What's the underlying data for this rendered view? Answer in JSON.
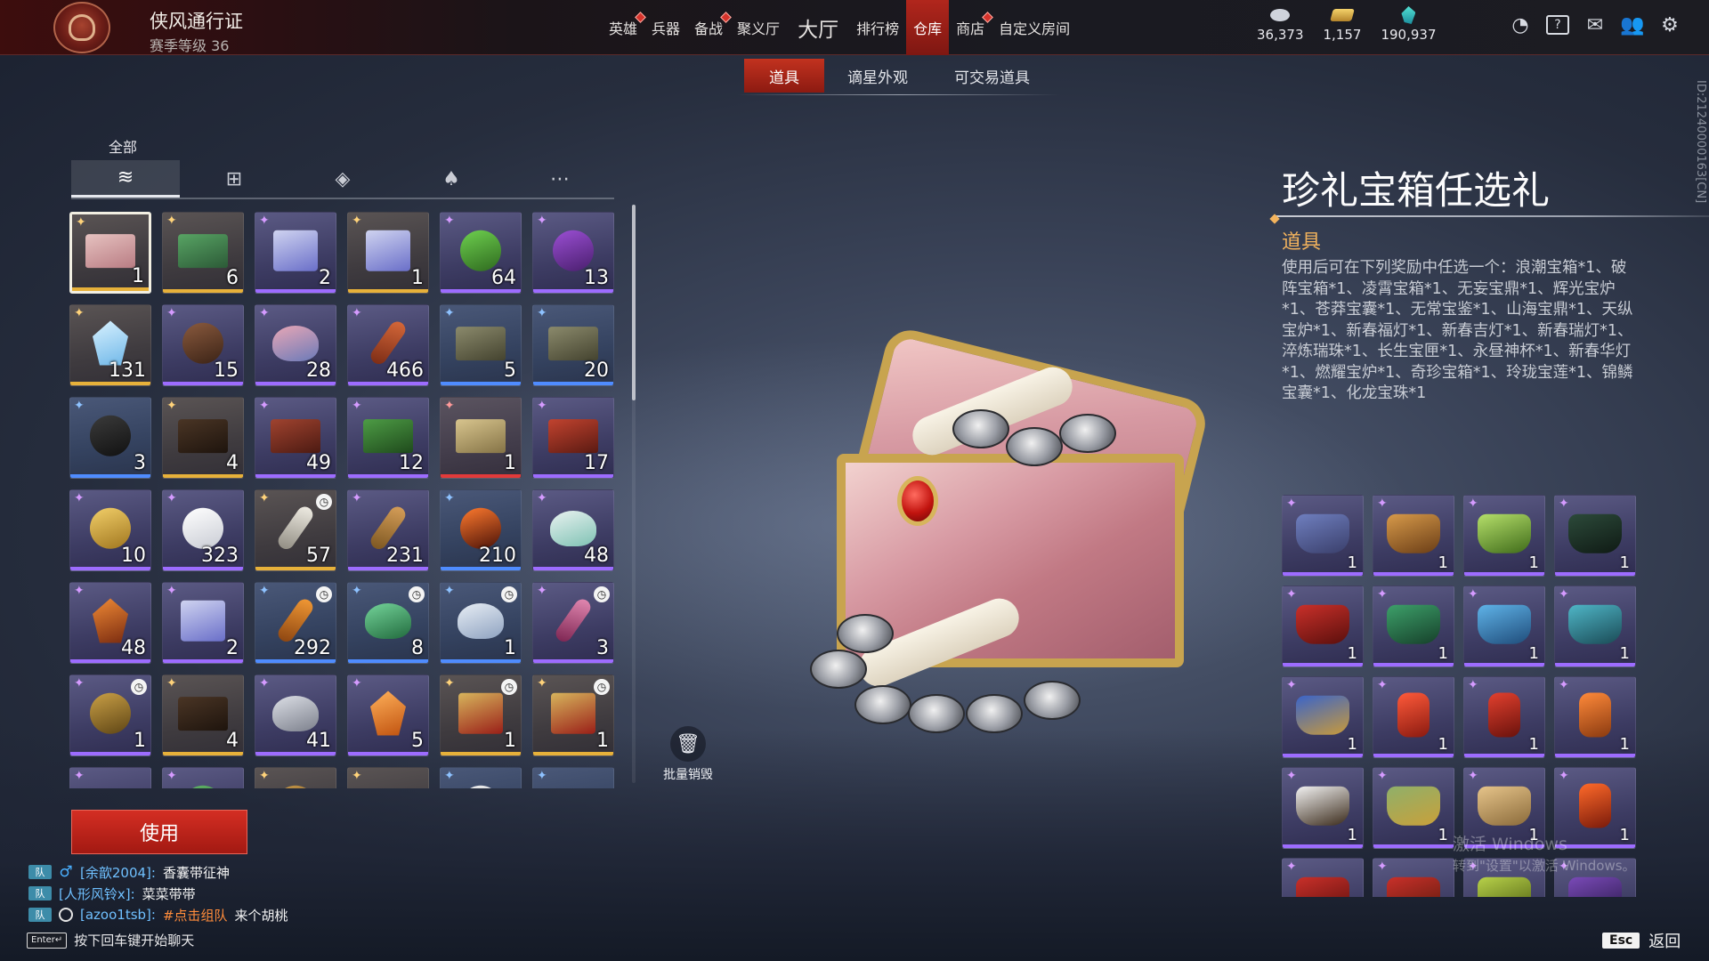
{
  "header": {
    "pass_title": "侠风通行证",
    "pass_level": "赛季等级 36",
    "nav": [
      {
        "label": "英雄",
        "badge": true,
        "size": "normal",
        "active": false
      },
      {
        "label": "兵器",
        "badge": false,
        "size": "normal",
        "active": false
      },
      {
        "label": "备战",
        "badge": true,
        "size": "normal",
        "active": false
      },
      {
        "label": "聚义厅",
        "badge": false,
        "size": "normal",
        "active": false
      },
      {
        "label": "大厅",
        "badge": false,
        "size": "big",
        "active": false
      },
      {
        "label": "排行榜",
        "badge": false,
        "size": "normal",
        "active": false
      },
      {
        "label": "仓库",
        "badge": false,
        "size": "normal",
        "active": true
      },
      {
        "label": "商店",
        "badge": true,
        "size": "normal",
        "active": false
      },
      {
        "label": "自定义房间",
        "badge": false,
        "size": "normal",
        "active": false
      }
    ],
    "currencies": [
      {
        "icon": "coin-pile-icon",
        "value": "36,373"
      },
      {
        "icon": "gold-bar-icon",
        "value": "1,157"
      },
      {
        "icon": "jade-crystal-icon",
        "value": "190,937"
      }
    ],
    "system_icons": [
      "timer-icon",
      "help-icon",
      "mail-icon",
      "friends-icon",
      "settings-icon"
    ]
  },
  "subtabs": [
    {
      "label": "道具",
      "active": true
    },
    {
      "label": "谪星外观",
      "active": false
    },
    {
      "label": "可交易道具",
      "active": false
    }
  ],
  "filters": {
    "active_label": "全部",
    "tabs": [
      {
        "icon": "layers-icon",
        "glyph": "≋",
        "active": true
      },
      {
        "icon": "gift-icon",
        "glyph": "⊞",
        "active": false
      },
      {
        "icon": "pouch-icon",
        "glyph": "◈",
        "active": false
      },
      {
        "icon": "flame-icon",
        "glyph": "♠",
        "active": false
      },
      {
        "icon": "more-icon",
        "glyph": "⋯",
        "active": false
      }
    ]
  },
  "inventory": [
    {
      "count": "1",
      "quality": "gold",
      "art": "chest",
      "colors": [
        "#e6c2c0",
        "#b97c83"
      ],
      "selected": true,
      "timed": false
    },
    {
      "count": "6",
      "quality": "gold",
      "art": "chest",
      "colors": [
        "#58a464",
        "#2c5a37"
      ],
      "selected": false,
      "timed": false
    },
    {
      "count": "2",
      "quality": "purple",
      "art": "box",
      "colors": [
        "#cfd3f0",
        "#6a6fc9"
      ],
      "selected": false,
      "timed": false
    },
    {
      "count": "1",
      "quality": "gold",
      "art": "box",
      "colors": [
        "#cfd3f0",
        "#6a6fc9"
      ],
      "selected": false,
      "timed": false
    },
    {
      "count": "64",
      "quality": "purple",
      "art": "orb",
      "colors": [
        "#6ed04f",
        "#2f6a1f"
      ],
      "selected": false,
      "timed": false
    },
    {
      "count": "13",
      "quality": "purple",
      "art": "orb",
      "colors": [
        "#9b4fd4",
        "#4a1f6e"
      ],
      "selected": false,
      "timed": false
    },
    {
      "count": "131",
      "quality": "gold",
      "art": "gem",
      "colors": [
        "#d9f2ff",
        "#6fb7e8"
      ],
      "selected": false,
      "timed": false
    },
    {
      "count": "15",
      "quality": "purple",
      "art": "orb",
      "colors": [
        "#8a5a3e",
        "#3b2316"
      ],
      "selected": false,
      "timed": false
    },
    {
      "count": "28",
      "quality": "purple",
      "art": "flower",
      "colors": [
        "#e9a7b6",
        "#6b7ab8"
      ],
      "selected": false,
      "timed": false
    },
    {
      "count": "466",
      "quality": "purple",
      "art": "key",
      "colors": [
        "#d7693a",
        "#7a2b15"
      ],
      "selected": false,
      "timed": false
    },
    {
      "count": "5",
      "quality": "blue",
      "art": "chest",
      "colors": [
        "#8b8a6c",
        "#44432f"
      ],
      "selected": false,
      "timed": false
    },
    {
      "count": "20",
      "quality": "blue",
      "art": "chest",
      "colors": [
        "#8b8a6c",
        "#44432f"
      ],
      "selected": false,
      "timed": false
    },
    {
      "count": "3",
      "quality": "blue",
      "art": "orb",
      "colors": [
        "#3b3b3b",
        "#111111"
      ],
      "selected": false,
      "timed": false
    },
    {
      "count": "4",
      "quality": "gold",
      "art": "chest",
      "colors": [
        "#4a3525",
        "#1e140d"
      ],
      "selected": false,
      "timed": false
    },
    {
      "count": "49",
      "quality": "purple",
      "art": "chest",
      "colors": [
        "#a0432f",
        "#4c1a12"
      ],
      "selected": false,
      "timed": false
    },
    {
      "count": "12",
      "quality": "purple",
      "art": "chest",
      "colors": [
        "#4d9c45",
        "#1f4a1c"
      ],
      "selected": false,
      "timed": false
    },
    {
      "count": "1",
      "quality": "red",
      "art": "chest",
      "colors": [
        "#d8c58e",
        "#857346"
      ],
      "selected": false,
      "timed": false
    },
    {
      "count": "17",
      "quality": "purple",
      "art": "chest",
      "colors": [
        "#c2432f",
        "#5a1a12"
      ],
      "selected": false,
      "timed": false
    },
    {
      "count": "10",
      "quality": "purple",
      "art": "orb",
      "colors": [
        "#f2cf69",
        "#a0761f"
      ],
      "selected": false,
      "timed": false
    },
    {
      "count": "323",
      "quality": "purple",
      "art": "orb",
      "colors": [
        "#ffffff",
        "#c9ccd4"
      ],
      "selected": false,
      "timed": false
    },
    {
      "count": "57",
      "quality": "gold",
      "art": "key",
      "colors": [
        "#f1eee5",
        "#8e8a80"
      ],
      "selected": false,
      "timed": true
    },
    {
      "count": "231",
      "quality": "purple",
      "art": "key",
      "colors": [
        "#d8a05a",
        "#7a5520"
      ],
      "selected": false,
      "timed": false
    },
    {
      "count": "210",
      "quality": "blue",
      "art": "orb",
      "colors": [
        "#ff7a2e",
        "#4b1208"
      ],
      "selected": false,
      "timed": false
    },
    {
      "count": "48",
      "quality": "purple",
      "art": "flower",
      "colors": [
        "#e9f2f0",
        "#7fc2b4"
      ],
      "selected": false,
      "timed": false
    },
    {
      "count": "48",
      "quality": "purple",
      "art": "gem",
      "colors": [
        "#f08a35",
        "#7a2b10"
      ],
      "selected": false,
      "timed": false
    },
    {
      "count": "2",
      "quality": "purple",
      "art": "box",
      "colors": [
        "#cfd3f0",
        "#6a6fc9"
      ],
      "selected": false,
      "timed": false
    },
    {
      "count": "292",
      "quality": "blue",
      "art": "key",
      "colors": [
        "#f39a35",
        "#8a4310"
      ],
      "selected": false,
      "timed": true
    },
    {
      "count": "8",
      "quality": "blue",
      "art": "flower",
      "colors": [
        "#74d49a",
        "#226b3e"
      ],
      "selected": false,
      "timed": true
    },
    {
      "count": "1",
      "quality": "blue",
      "art": "flower",
      "colors": [
        "#e8eef5",
        "#8ea2c0"
      ],
      "selected": false,
      "timed": true
    },
    {
      "count": "3",
      "quality": "purple",
      "art": "key",
      "colors": [
        "#e48ab3",
        "#7b2350"
      ],
      "selected": false,
      "timed": true
    },
    {
      "count": "1",
      "quality": "purple",
      "art": "orb",
      "colors": [
        "#caa046",
        "#5e4515"
      ],
      "selected": false,
      "timed": true
    },
    {
      "count": "4",
      "quality": "gold",
      "art": "chest",
      "colors": [
        "#4a3525",
        "#1e140d"
      ],
      "selected": false,
      "timed": false
    },
    {
      "count": "41",
      "quality": "purple",
      "art": "flower",
      "colors": [
        "#dcdfe6",
        "#7c808c"
      ],
      "selected": false,
      "timed": false
    },
    {
      "count": "5",
      "quality": "purple",
      "art": "gem",
      "colors": [
        "#ffb15a",
        "#c0520f"
      ],
      "selected": false,
      "timed": false
    },
    {
      "count": "1",
      "quality": "gold",
      "art": "box",
      "colors": [
        "#d7b55c",
        "#9a1f18"
      ],
      "selected": false,
      "timed": true
    },
    {
      "count": "1",
      "quality": "gold",
      "art": "box",
      "colors": [
        "#d7b55c",
        "#9a1f18"
      ],
      "selected": false,
      "timed": true
    },
    {
      "count": "",
      "quality": "purple",
      "art": "chest",
      "colors": [
        "#c99a4a",
        "#5a3c16"
      ],
      "selected": false,
      "timed": false
    },
    {
      "count": "",
      "quality": "purple",
      "art": "orb",
      "colors": [
        "#63b86a",
        "#255a2a"
      ],
      "selected": false,
      "timed": false
    },
    {
      "count": "",
      "quality": "gold",
      "art": "orb",
      "colors": [
        "#c99a4a",
        "#5a3c16"
      ],
      "selected": false,
      "timed": false
    },
    {
      "count": "",
      "quality": "gold",
      "art": "chest",
      "colors": [
        "#c99a4a",
        "#5a3c16"
      ],
      "selected": false,
      "timed": false
    },
    {
      "count": "",
      "quality": "blue",
      "art": "orb",
      "colors": [
        "#f2f2f2",
        "#a7abb4"
      ],
      "selected": false,
      "timed": false
    },
    {
      "count": "",
      "quality": "blue",
      "art": "chest",
      "colors": [
        "#c99a4a",
        "#5a3c16"
      ],
      "selected": false,
      "timed": false
    }
  ],
  "actions": {
    "destroy_label": "批量销毁",
    "use_label": "使用"
  },
  "detail": {
    "title": "珍礼宝箱任选礼",
    "category": "道具",
    "description": "使用后可在下列奖励中任选一个：浪潮宝箱*1、破阵宝箱*1、凌霄宝箱*1、无妄宝鼎*1、辉光宝炉*1、苍莽宝囊*1、无常宝鉴*1、山海宝鼎*1、天纵宝炉*1、新春福灯*1、新春吉灯*1、新春瑞灯*1、淬炼瑞珠*1、长生宝匣*1、永昼神杯*1、新春华灯*1、燃耀宝炉*1、奇珍宝箱*1、玲珑宝莲*1、锦鳞宝囊*1、化龙宝珠*1"
  },
  "rewards": [
    {
      "count": "1",
      "art": "cauldron",
      "colors": [
        "#6f7fbf",
        "#3a3f6b"
      ]
    },
    {
      "count": "1",
      "art": "cauldron",
      "colors": [
        "#d79a4a",
        "#6a3d16"
      ]
    },
    {
      "count": "1",
      "art": "cauldron",
      "colors": [
        "#b5df6a",
        "#3f6b1a"
      ]
    },
    {
      "count": "1",
      "art": "cauldron",
      "colors": [
        "#2c4a3a",
        "#0f1a14"
      ]
    },
    {
      "count": "1",
      "art": "cauldron",
      "colors": [
        "#c9302a",
        "#5a0f0c"
      ]
    },
    {
      "count": "1",
      "art": "cauldron",
      "colors": [
        "#3da06a",
        "#16402a"
      ]
    },
    {
      "count": "1",
      "art": "cauldron",
      "colors": [
        "#5fb3e8",
        "#1f4c7a"
      ]
    },
    {
      "count": "1",
      "art": "cauldron",
      "colors": [
        "#4fb6c7",
        "#1a4a55"
      ]
    },
    {
      "count": "1",
      "art": "cauldron",
      "colors": [
        "#3a64c9",
        "#c99a3a"
      ]
    },
    {
      "count": "1",
      "art": "lantern",
      "colors": [
        "#ff5a3a",
        "#8a1a10"
      ]
    },
    {
      "count": "1",
      "art": "lantern",
      "colors": [
        "#e2402e",
        "#6a120c"
      ]
    },
    {
      "count": "1",
      "art": "lantern",
      "colors": [
        "#ff8a3a",
        "#8a3a10"
      ]
    },
    {
      "count": "1",
      "art": "cauldron",
      "colors": [
        "#f2f2f2",
        "#3a2a1a"
      ]
    },
    {
      "count": "1",
      "art": "cauldron",
      "colors": [
        "#8fb06a",
        "#c9a03a"
      ]
    },
    {
      "count": "1",
      "art": "cauldron",
      "colors": [
        "#e6c48a",
        "#8a6a3a"
      ]
    },
    {
      "count": "1",
      "art": "lantern",
      "colors": [
        "#ff6a2a",
        "#7a1a0a"
      ]
    },
    {
      "count": "",
      "art": "cauldron",
      "colors": [
        "#c9302a",
        "#5a0f0c"
      ]
    },
    {
      "count": "",
      "art": "cauldron",
      "colors": [
        "#c9302a",
        "#5a1a0c"
      ]
    },
    {
      "count": "",
      "art": "cauldron",
      "colors": [
        "#b8d24a",
        "#4a5a10"
      ]
    },
    {
      "count": "",
      "art": "cauldron",
      "colors": [
        "#7a4ab8",
        "#2a1a4a"
      ]
    }
  ],
  "chat": [
    {
      "channel": "队",
      "gender": "♂",
      "name": "[余歆2004]:",
      "highlight": "",
      "message": "香囊带征神"
    },
    {
      "channel": "队",
      "gender": "",
      "name": "[人形风铃x]:",
      "highlight": "",
      "message": "菜菜带带"
    },
    {
      "channel": "队",
      "gender": "",
      "name": "[azoo1tsb]:",
      "highlight": "#点击组队",
      "message": " 来个胡桃"
    }
  ],
  "enter_hint": {
    "key": "Enter↵",
    "text": "按下回车键开始聊天"
  },
  "watermark": {
    "line1": "激活 Windows",
    "line2": "转到\"设置\"以激活 Windows。"
  },
  "side_id": "ID:21240000163[CN]",
  "esc": {
    "key": "Esc",
    "label": "返回"
  }
}
